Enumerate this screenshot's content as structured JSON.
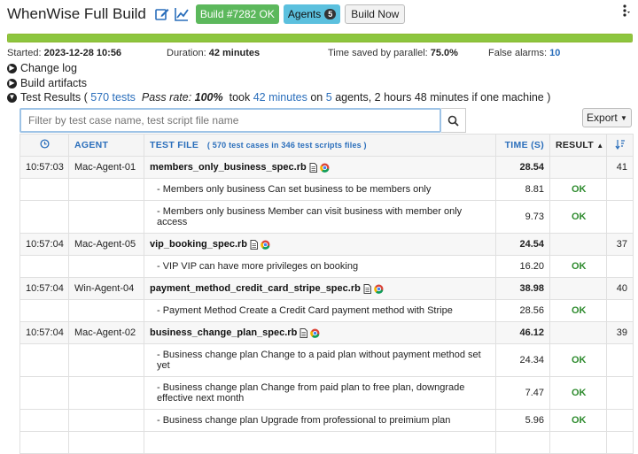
{
  "header": {
    "title": "WhenWise Full Build",
    "build_label": "Build #7282 OK",
    "agents_label": "Agents",
    "agents_count": "5",
    "build_now_label": "Build Now",
    "menu_icon": "vertical-dots-icon"
  },
  "progress": {
    "fraction": 1.0,
    "color": "#8cc63f"
  },
  "stats": {
    "started_label": "Started:",
    "started_value": "2023-12-28 10:56",
    "duration_label": "Duration:",
    "duration_value": "42 minutes",
    "saved_label": "Time saved by parallel:",
    "saved_value": "75.0%",
    "false_alarms_label": "False alarms:",
    "false_alarms_value": "10"
  },
  "sections": {
    "change_log": "Change log",
    "build_artifacts": "Build artifacts",
    "test_results": "Test Results",
    "tests_count": "570 tests",
    "pass_rate_label": "Pass rate:",
    "pass_rate_value": "100%",
    "took": "took",
    "took_time": "42 minutes",
    "on": "on",
    "agents_num": "5",
    "agents_suffix": "agents, 2 hours 48 minutes if one machine )"
  },
  "search": {
    "placeholder": "Filter by test case name, test script file name"
  },
  "export_label": "Export",
  "table": {
    "col_agent": "AGENT",
    "col_file": "TEST FILE",
    "col_file_sub": "( 570 test cases in 346 test scripts files )",
    "col_time": "TIME (S)",
    "col_result": "RESULT",
    "rows": [
      {
        "kind": "file",
        "time": "10:57:03",
        "agent": "Mac-Agent-01",
        "name": "members_only_business_spec.rb",
        "duration": "28.54",
        "seq": "41"
      },
      {
        "kind": "case",
        "name": "- Members only business Can set business to be members only",
        "duration": "8.81",
        "result": "OK"
      },
      {
        "kind": "case",
        "name": "- Members only business Member can visit business with member only access",
        "duration": "9.73",
        "result": "OK",
        "tall": true
      },
      {
        "kind": "file",
        "time": "10:57:04",
        "agent": "Mac-Agent-05",
        "name": "vip_booking_spec.rb",
        "duration": "24.54",
        "seq": "37"
      },
      {
        "kind": "case",
        "name": "- VIP VIP can have more privileges on booking",
        "duration": "16.20",
        "result": "OK"
      },
      {
        "kind": "file",
        "time": "10:57:04",
        "agent": "Win-Agent-04",
        "name": "payment_method_credit_card_stripe_spec.rb",
        "duration": "38.98",
        "seq": "40"
      },
      {
        "kind": "case",
        "name": "- Payment Method Create a Credit Card payment method with Stripe",
        "duration": "28.56",
        "result": "OK"
      },
      {
        "kind": "file",
        "time": "10:57:04",
        "agent": "Mac-Agent-02",
        "name": "business_change_plan_spec.rb",
        "duration": "46.12",
        "seq": "39"
      },
      {
        "kind": "case",
        "name": "- Business change plan Change to a paid plan without payment method set yet",
        "duration": "24.34",
        "result": "OK",
        "tall": true
      },
      {
        "kind": "case",
        "name": "- Business change plan Change from paid plan to free plan, downgrade effective next month",
        "duration": "7.47",
        "result": "OK",
        "tall": true
      },
      {
        "kind": "case",
        "name": "- Business change plan Upgrade from professional to preimium plan",
        "duration": "5.96",
        "result": "OK"
      },
      {
        "kind": "case",
        "name": "",
        "duration": "",
        "result": ""
      }
    ]
  }
}
